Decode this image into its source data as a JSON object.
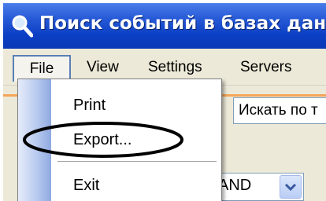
{
  "window": {
    "title": "Поиск событий в базах данн",
    "icon": "search-icon"
  },
  "menubar": {
    "items": [
      {
        "label": "File",
        "active": true
      },
      {
        "label": "View"
      },
      {
        "label": "Settings"
      },
      {
        "label": "Servers"
      }
    ]
  },
  "file_menu": {
    "items": [
      {
        "label": "Print"
      },
      {
        "label": "Export..."
      },
      {
        "label": "Exit"
      }
    ],
    "highlighted_item": "Export..."
  },
  "toolbar": {
    "search_label": "Искать по т"
  },
  "filter": {
    "operator_value": "AND"
  },
  "colors": {
    "titlebar": "#0b3fc4",
    "menu_bg": "#ece9d8",
    "accent_line": "#f4a55a"
  }
}
